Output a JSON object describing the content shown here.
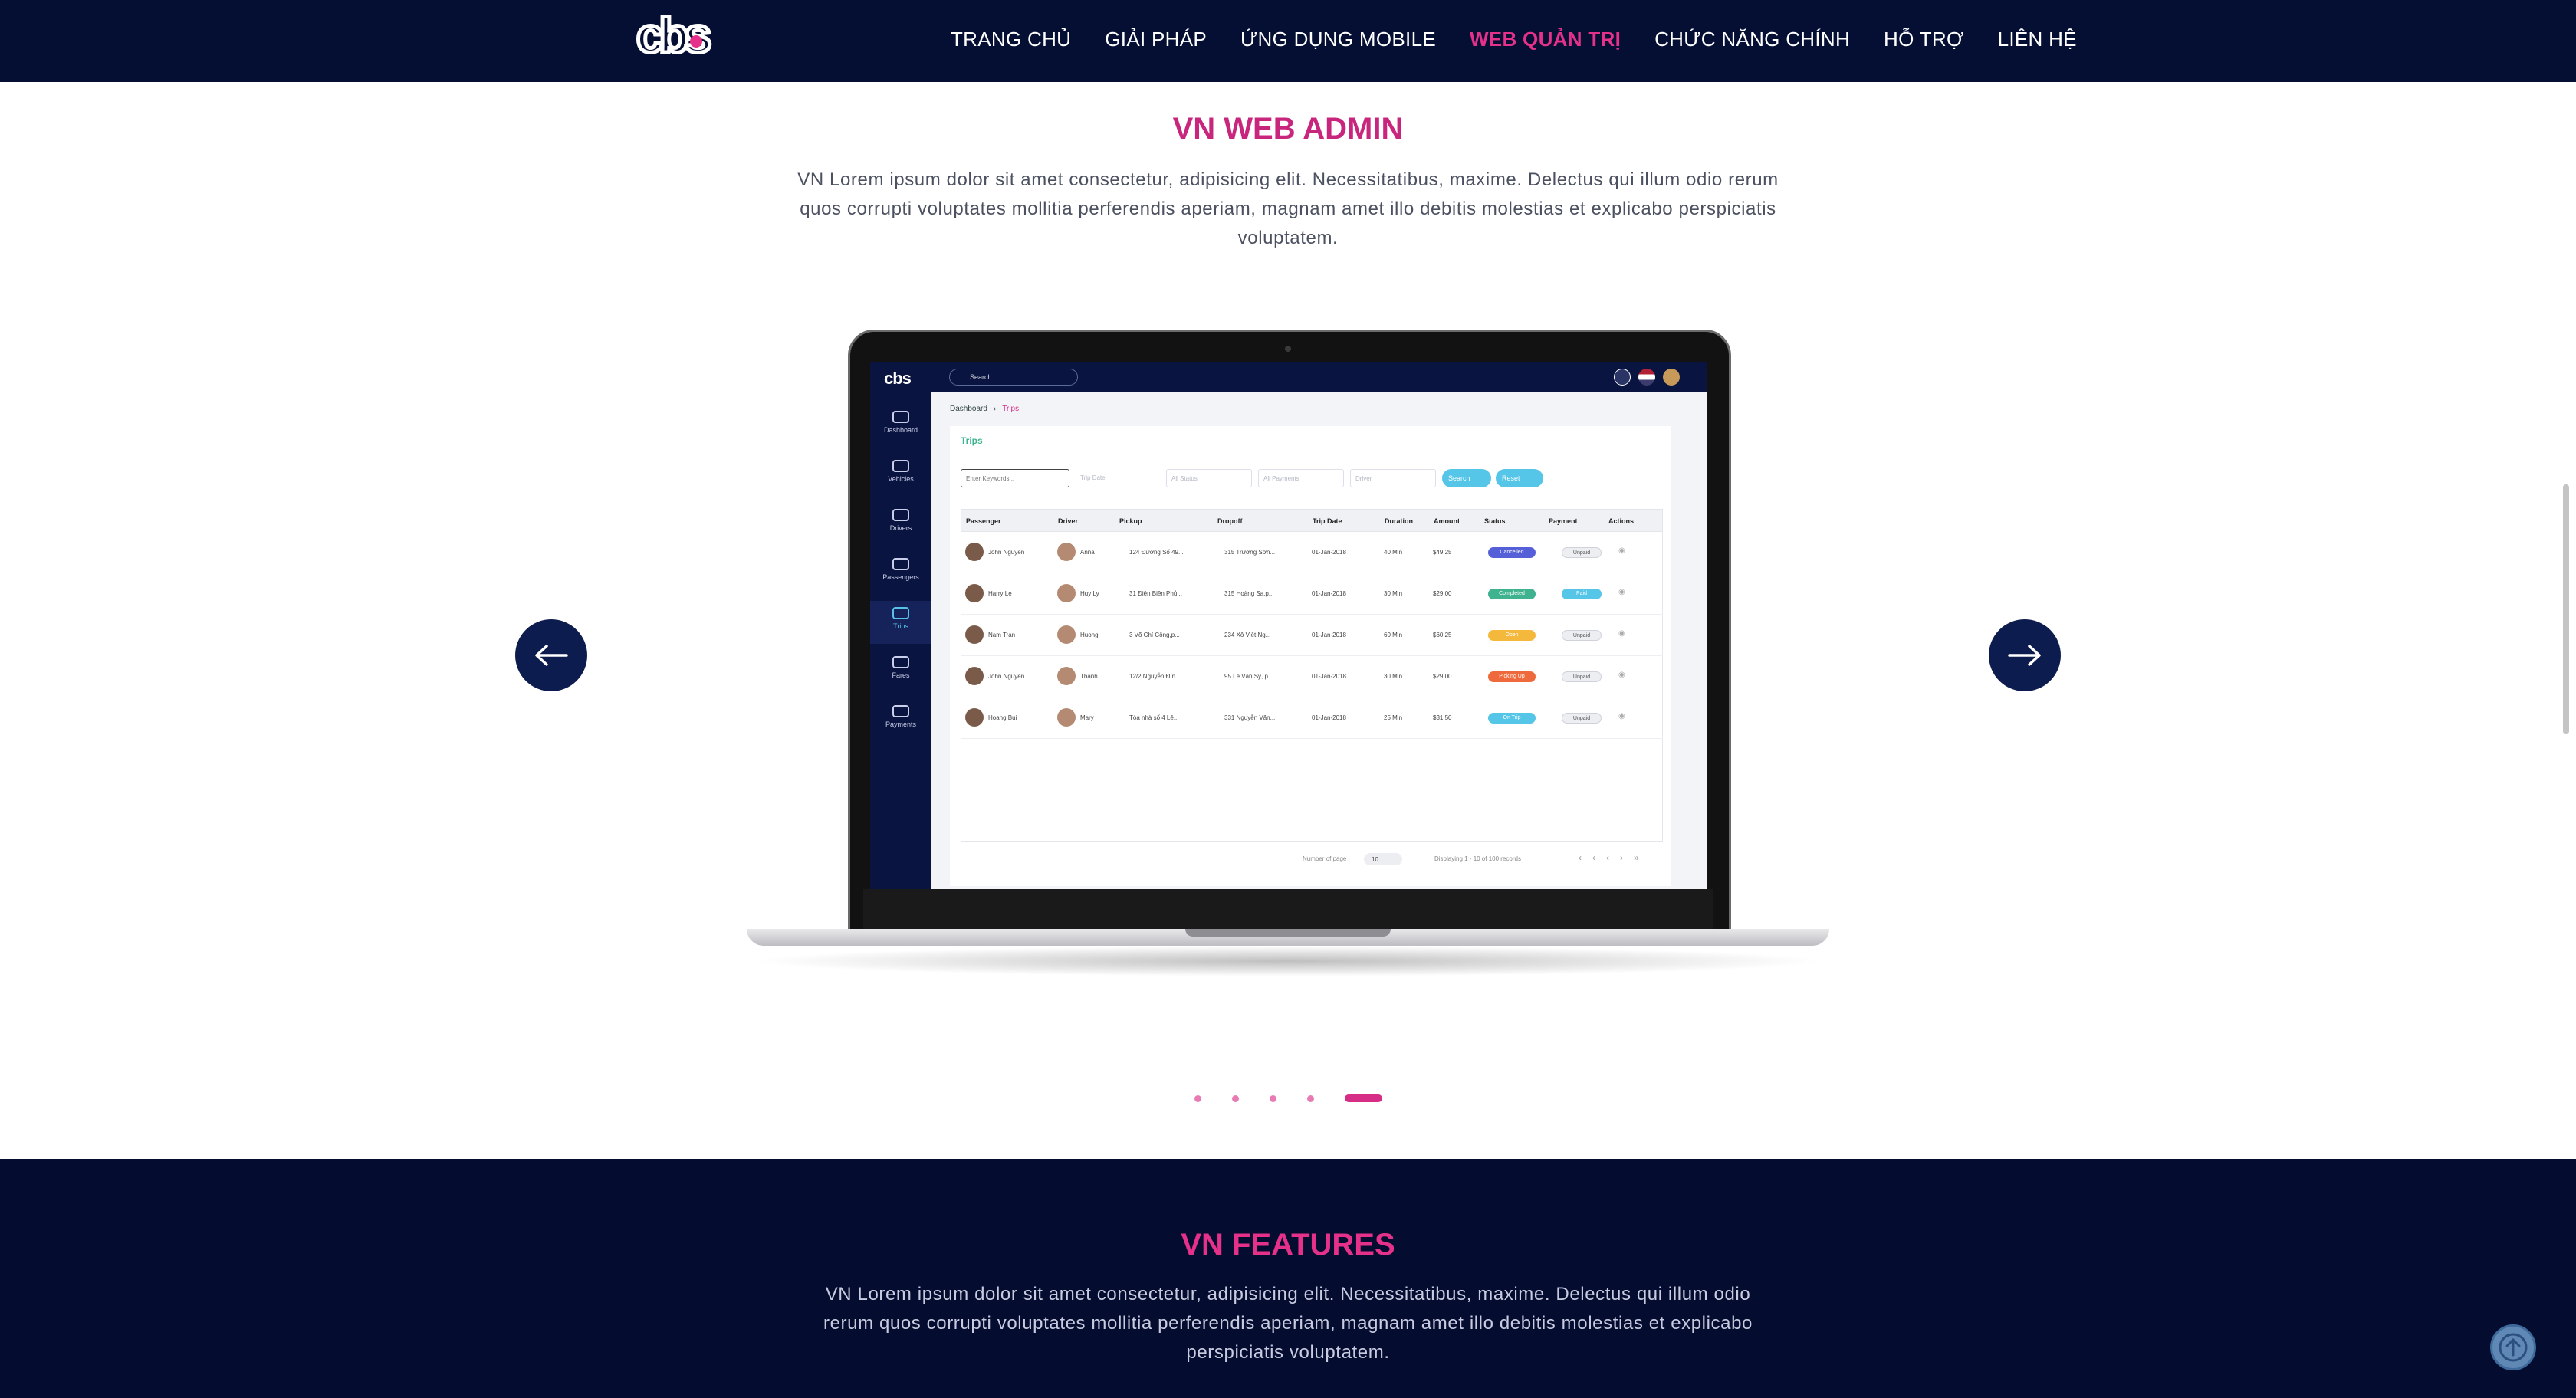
{
  "nav": {
    "logo": "cbs",
    "items": [
      {
        "label": "TRANG CHỦ",
        "active": false
      },
      {
        "label": "GIẢI PHÁP",
        "active": false
      },
      {
        "label": "ỨNG DỤNG MOBILE",
        "active": false
      },
      {
        "label": "WEB QUẢN TRỊ",
        "active": true
      },
      {
        "label": "CHỨC NĂNG CHÍNH",
        "active": false
      },
      {
        "label": "HỖ TRỢ",
        "active": false
      },
      {
        "label": "LIÊN HỆ",
        "active": false
      }
    ]
  },
  "section_admin": {
    "title": "VN WEB ADMIN",
    "description": "VN Lorem ipsum dolor sit amet consectetur, adipisicing elit. Necessitatibus, maxime. Delectus qui illum odio rerum quos corrupti voluptates mollitia perferendis aperiam, magnam amet illo debitis molestias et explicabo perspiciatis voluptatem."
  },
  "carousel": {
    "slide_count": 5,
    "active_index": 4,
    "prev_icon": "arrow-left-icon",
    "next_icon": "arrow-right-icon"
  },
  "screen": {
    "logo": "cbs",
    "search_placeholder": "Search...",
    "sidebar": [
      "Dashboard",
      "Vehicles",
      "Drivers",
      "Passengers",
      "Trips",
      "Fares",
      "Payments"
    ],
    "active_sidebar": "Trips",
    "breadcrumb": [
      "Dashboard",
      "Trips"
    ],
    "card_title": "Trips",
    "filters": {
      "keywords": "Enter Keywords...",
      "trip_date": "Trip Date",
      "status": "All Status",
      "payments": "All Payments",
      "driver": "Driver",
      "search_btn": "Search",
      "reset_btn": "Reset"
    },
    "columns": [
      "Passenger",
      "Driver",
      "Pickup",
      "Dropoff",
      "Trip Date",
      "Duration",
      "Amount",
      "Status",
      "Payment",
      "Actions"
    ],
    "rows": [
      {
        "passenger": "John Nguyen",
        "driver": "Anna",
        "pickup": "124 Đường Số 49...",
        "dropoff": "315 Trường Sơn...",
        "date": "01-Jan-2018",
        "duration": "40 Min",
        "amount": "$49.25",
        "status": "Cancelled",
        "status_color": "#5560d8",
        "payment": "Unpaid"
      },
      {
        "passenger": "Harry Le",
        "driver": "Huy Ly",
        "pickup": "31 Điện Biên Phủ...",
        "dropoff": "315 Hoàng Sa,p...",
        "date": "01-Jan-2018",
        "duration": "30 Min",
        "amount": "$29.00",
        "status": "Completed",
        "status_color": "#3fb38f",
        "payment": "Paid"
      },
      {
        "passenger": "Nam Tran",
        "driver": "Huong",
        "pickup": "3 Võ Chí Công,p...",
        "dropoff": "234 Xô Viết Ng...",
        "date": "01-Jan-2018",
        "duration": "60 Min",
        "amount": "$60.25",
        "status": "Open",
        "status_color": "#f4b93c",
        "payment": "Unpaid"
      },
      {
        "passenger": "John Nguyen",
        "driver": "Thanh",
        "pickup": "12/2 Nguyễn Đìn...",
        "dropoff": "95 Lê Văn Sỹ, p...",
        "date": "01-Jan-2018",
        "duration": "30 Min",
        "amount": "$29.00",
        "status": "Picking Up",
        "status_color": "#ee6a3c",
        "payment": "Unpaid"
      },
      {
        "passenger": "Hoang Bui",
        "driver": "Mary",
        "pickup": "Tòa nhà số 4 Lê...",
        "dropoff": "331 Nguyễn Văn...",
        "date": "01-Jan-2018",
        "duration": "25 Min",
        "amount": "$31.50",
        "status": "On Trip",
        "status_color": "#55c5e8",
        "payment": "Unpaid"
      }
    ],
    "pagination": {
      "label": "Number of page",
      "per_page": "10",
      "summary": "Displaying 1 - 10 of 100 records"
    }
  },
  "section_features": {
    "title": "VN FEATURES",
    "description": "VN Lorem ipsum dolor sit amet consectetur, adipisicing elit. Necessitatibus, maxime. Delectus qui illum odio rerum quos corrupti voluptates mollitia perferendis aperiam, magnam amet illo debitis molestias et explicabo perspiciatis voluptatem."
  },
  "colors": {
    "navy": "#050e33",
    "accent": "#c8257c",
    "arrow_bg": "#0d1c4f"
  },
  "back_to_top_icon": "arrow-up-icon"
}
